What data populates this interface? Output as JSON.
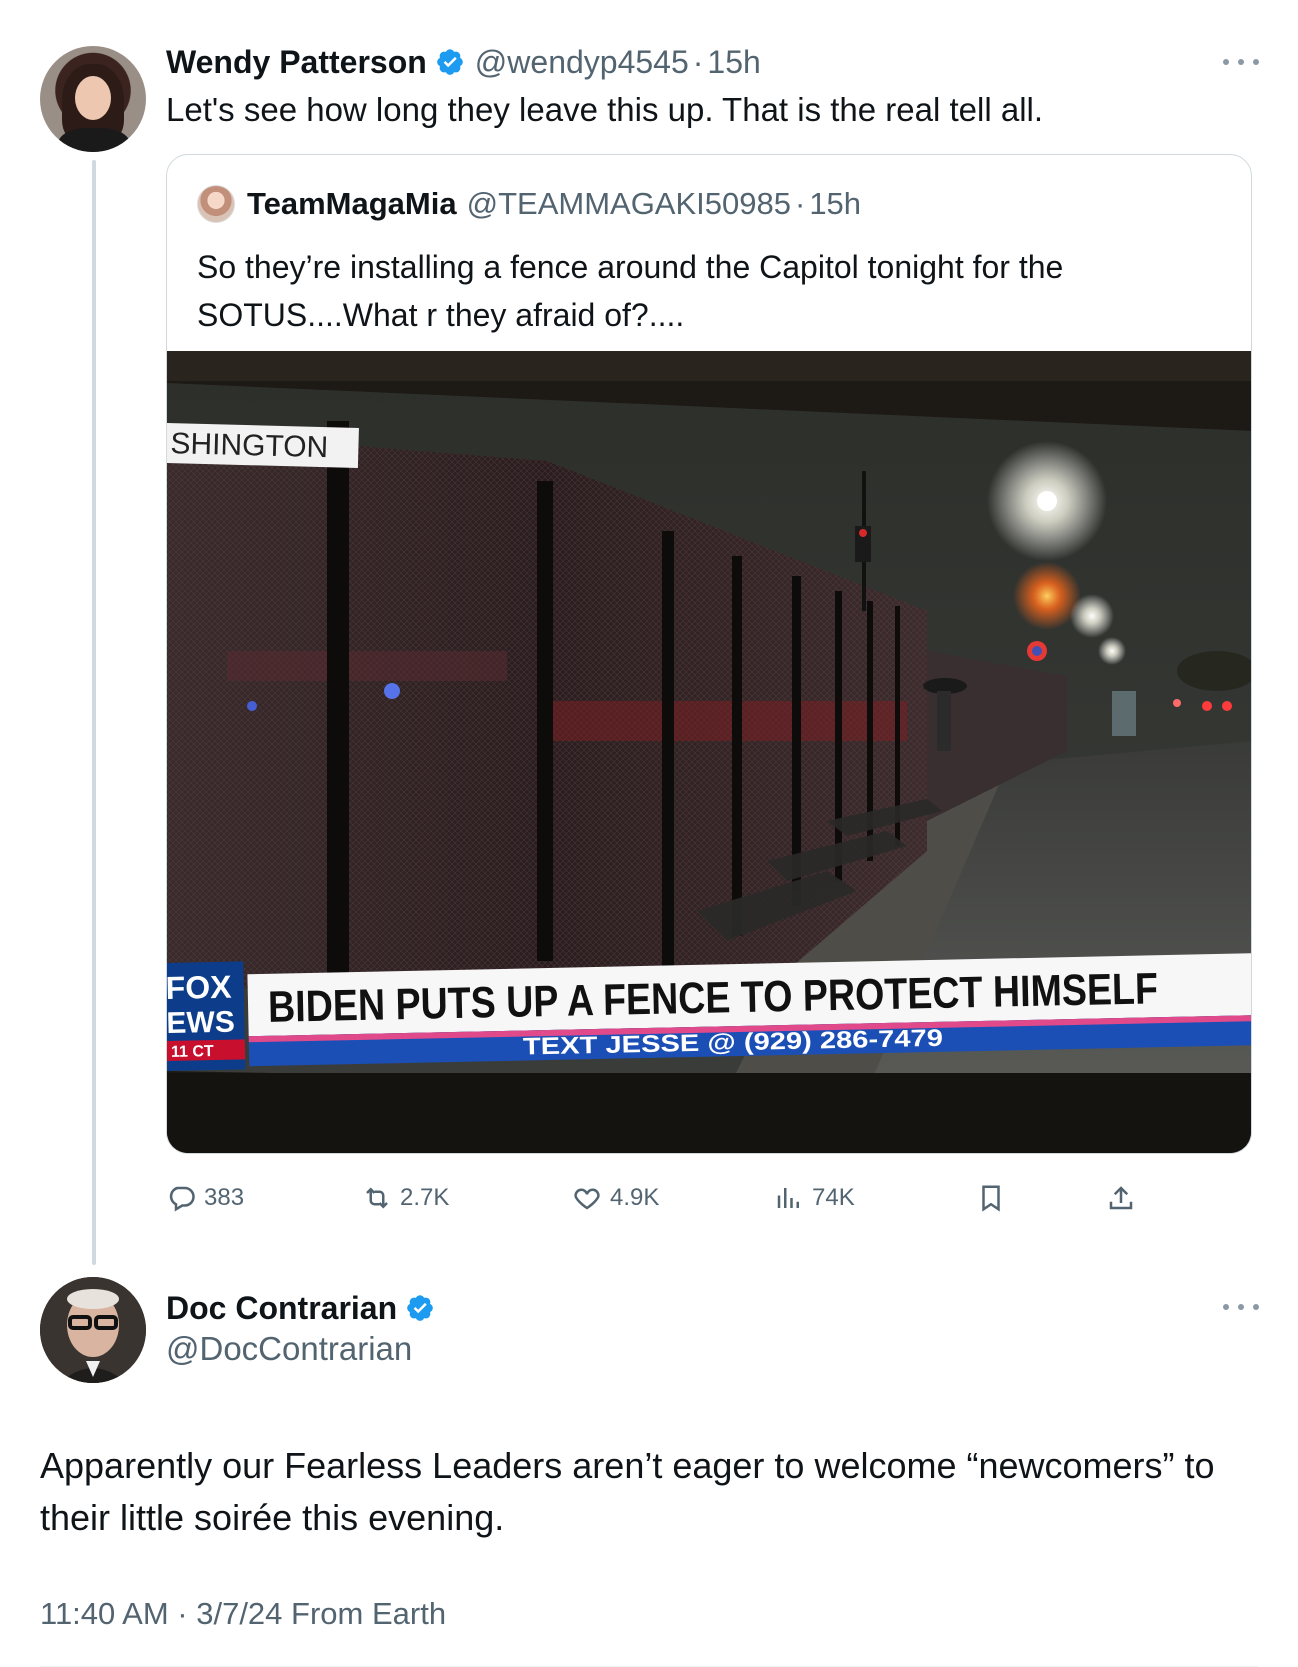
{
  "tweet1": {
    "name": "Wendy Patterson",
    "handle": "@wendyp4545",
    "separator": "·",
    "time": "15h",
    "text": "Let's see how long they leave this up.  That is the real tell all."
  },
  "quote": {
    "name": "TeamMagaMia",
    "handle": "@TEAMMAGAKI50985",
    "separator": "·",
    "time": "15h",
    "text": "So they’re installing a fence around the Capitol tonight for the SOTUS....What r they afraid of?....",
    "image": {
      "location_tag": "SHINGTON",
      "network_logo_top": "FOX",
      "network_logo_bottom": "EWS",
      "network_time": "11 CT",
      "headline": "BIDEN PUTS UP A FENCE TO PROTECT HIMSELF",
      "ticker": "TEXT JESSE @ (929) 286-7479"
    }
  },
  "actions": {
    "replies": "383",
    "reposts": "2.7K",
    "likes": "4.9K",
    "views": "74K"
  },
  "tweet2": {
    "name": "Doc Contrarian",
    "handle": "@DocContrarian",
    "text": "Apparently our Fearless Leaders aren’t eager to welcome “newcomers” to their little soirée this evening.",
    "timestamp": "11:40 AM · 3/7/24 From Earth"
  },
  "colors": {
    "verified": "#1d9bf0",
    "secondary_text": "#536471",
    "border": "#cfd9de"
  }
}
